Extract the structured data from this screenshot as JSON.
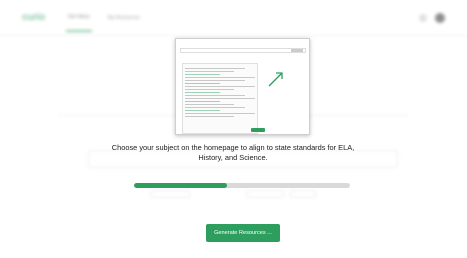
{
  "app": {
    "logo_text": "curio",
    "nav_tabs": [
      "Get Ideas",
      "My Resources"
    ]
  },
  "tutorial": {
    "caption": "Choose your subject on the homepage to align to state standards for ELA, History, and Science.",
    "progress_fraction": 0.43
  },
  "actions": {
    "generate_label": "Generate Resources ..."
  },
  "colors": {
    "accent": "#2e9e5f",
    "track": "#d9d9d9"
  }
}
